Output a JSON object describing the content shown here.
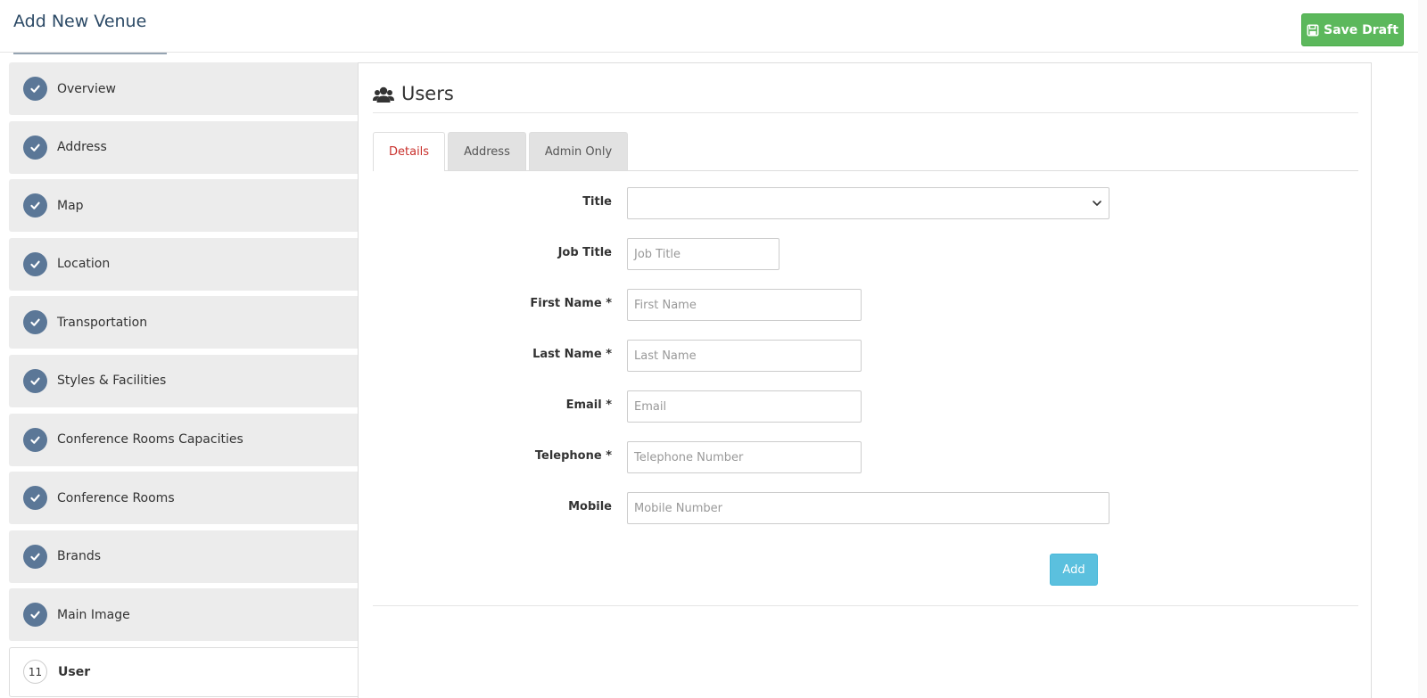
{
  "header": {
    "title": "Add New Venue",
    "save_label": "Save Draft"
  },
  "sidebar": {
    "steps": [
      {
        "label": "Overview",
        "status": "complete"
      },
      {
        "label": "Address",
        "status": "complete"
      },
      {
        "label": "Map",
        "status": "complete"
      },
      {
        "label": "Location",
        "status": "complete"
      },
      {
        "label": "Transportation",
        "status": "complete"
      },
      {
        "label": "Styles & Facilities",
        "status": "complete"
      },
      {
        "label": "Conference Rooms Capacities",
        "status": "complete"
      },
      {
        "label": "Conference Rooms",
        "status": "complete"
      },
      {
        "label": "Brands",
        "status": "complete"
      },
      {
        "label": "Main Image",
        "status": "complete"
      },
      {
        "label": "User",
        "status": "active",
        "number": "11"
      }
    ]
  },
  "panel": {
    "title": "Users",
    "tabs": [
      {
        "label": "Details",
        "active": true
      },
      {
        "label": "Address",
        "active": false
      },
      {
        "label": "Admin Only",
        "active": false
      }
    ]
  },
  "form": {
    "title_label": "Title",
    "title_value": "",
    "job_title_label": "Job Title",
    "job_title_placeholder": "Job Title",
    "first_name_label": "First Name *",
    "first_name_placeholder": "First Name",
    "last_name_label": "Last Name *",
    "last_name_placeholder": "Last Name",
    "email_label": "Email *",
    "email_placeholder": "Email",
    "telephone_label": "Telephone *",
    "telephone_placeholder": "Telephone Number",
    "mobile_label": "Mobile",
    "mobile_placeholder": "Mobile Number",
    "add_label": "Add"
  },
  "colors": {
    "save": "#5cb85c",
    "add": "#5bc0de",
    "step_check": "#5b7797",
    "active_tab_text": "#c9302c"
  }
}
